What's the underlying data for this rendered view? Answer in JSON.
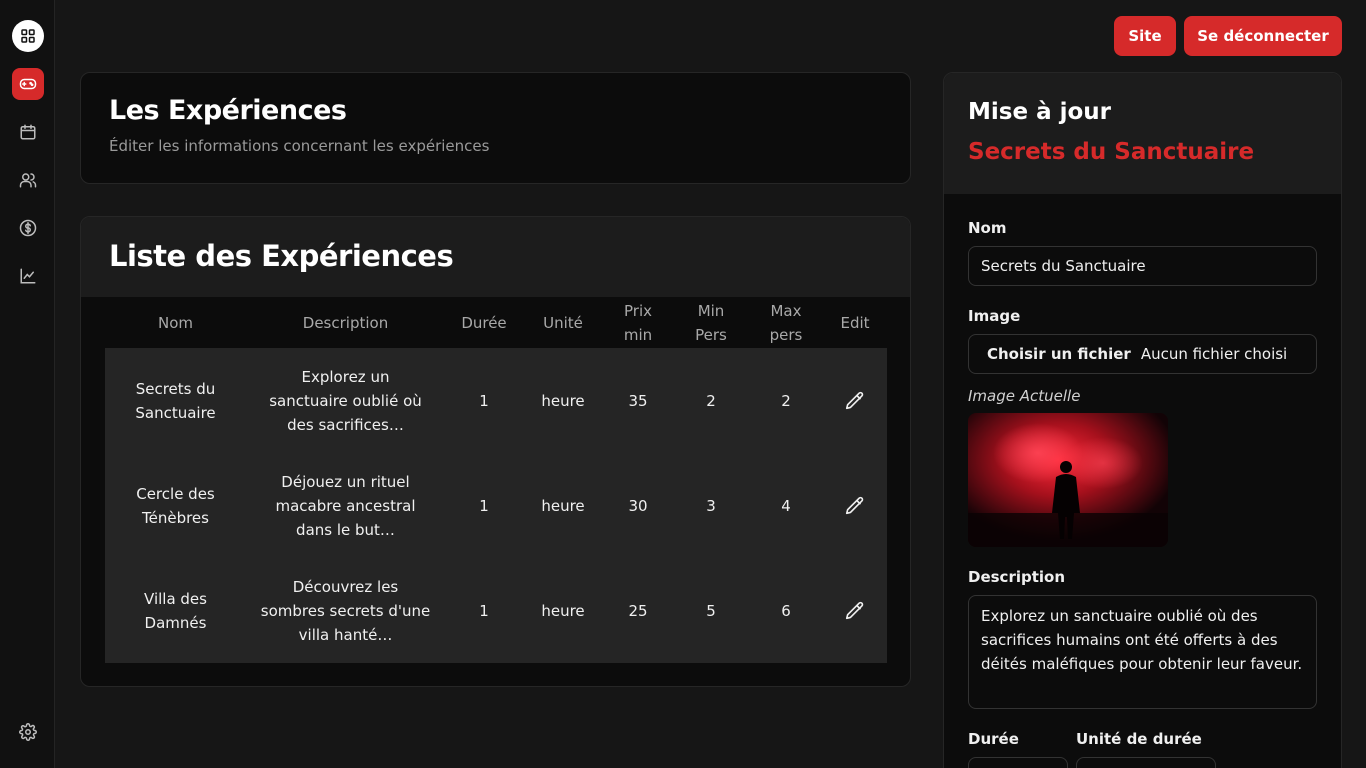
{
  "sidebar": {
    "items": [
      {
        "name": "dashboard-icon"
      },
      {
        "name": "gamepad-icon"
      },
      {
        "name": "calendar-icon"
      },
      {
        "name": "users-icon"
      },
      {
        "name": "dollar-icon"
      },
      {
        "name": "chart-icon"
      },
      {
        "name": "settings-icon"
      }
    ]
  },
  "topbar": {
    "site_label": "Site",
    "logout_label": "Se déconnecter"
  },
  "header": {
    "title": "Les Expériences",
    "subtitle": "Éditer les informations concernant les expériences"
  },
  "list": {
    "title": "Liste des Expériences",
    "columns": [
      "Nom",
      "Description",
      "Durée",
      "Unité",
      "Prix min",
      "Min Pers",
      "Max pers",
      "Edit"
    ],
    "rows": [
      {
        "nom": "Secrets du Sanctuaire",
        "description": "Explorez un sanctuaire oublié où des sacrifices…",
        "duree": "1",
        "unite": "heure",
        "prix_min": "35",
        "min_pers": "2",
        "max_pers": "2"
      },
      {
        "nom": "Cercle des Ténèbres",
        "description": "Déjouez un rituel macabre ancestral dans le but…",
        "duree": "1",
        "unite": "heure",
        "prix_min": "30",
        "min_pers": "3",
        "max_pers": "4"
      },
      {
        "nom": "Villa des Damnés",
        "description": "Découvrez les sombres secrets d'une villa hanté…",
        "duree": "1",
        "unite": "heure",
        "prix_min": "25",
        "min_pers": "5",
        "max_pers": "6"
      }
    ]
  },
  "edit_panel": {
    "title": "Mise à jour",
    "subtitle": "Secrets du Sanctuaire",
    "nom_label": "Nom",
    "nom_value": "Secrets du Sanctuaire",
    "image_label": "Image",
    "file_button": "Choisir un fichier",
    "file_status": "Aucun fichier choisi",
    "current_image_label": "Image Actuelle",
    "description_label": "Description",
    "description_value": "Explorez un sanctuaire oublié où des sacrifices humains ont été offerts à des déités maléfiques pour obtenir leur faveur.",
    "duree_label": "Durée",
    "unite_label": "Unité de durée"
  },
  "colors": {
    "accent": "#d62a2a",
    "background": "#161616",
    "card": "#0c0c0c",
    "table_body": "#252525"
  }
}
